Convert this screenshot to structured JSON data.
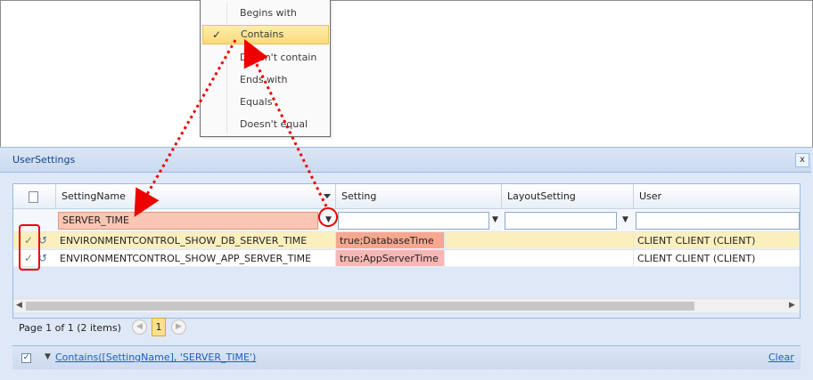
{
  "filter_menu": {
    "items": [
      {
        "label": "Begins with",
        "selected": false
      },
      {
        "label": "Contains",
        "selected": true
      },
      {
        "label": "Doesn't contain",
        "selected": false
      },
      {
        "label": "Ends with",
        "selected": false
      },
      {
        "label": "Equals",
        "selected": false
      },
      {
        "label": "Doesn't equal",
        "selected": false
      }
    ]
  },
  "window": {
    "title": "UserSettings",
    "close_label": "x"
  },
  "grid": {
    "columns": [
      "SettingName",
      "Setting",
      "LayoutSetting",
      "User"
    ],
    "filter_values": {
      "setting_name": "SERVER_TIME",
      "setting": "",
      "layout_setting": "",
      "user": ""
    },
    "rows": [
      {
        "setting_name": "ENVIRONMENTCONTROL_SHOW_DB_SERVER_TIME",
        "setting": "true;DatabaseTime",
        "layout_setting": "",
        "user": "CLIENT CLIENT (CLIENT)"
      },
      {
        "setting_name": "ENVIRONMENTCONTROL_SHOW_APP_SERVER_TIME",
        "setting": "true;AppServerTime",
        "layout_setting": "",
        "user": "CLIENT CLIENT (CLIENT)"
      }
    ]
  },
  "pager": {
    "summary": "Page 1 of 1 (2 items)",
    "current_page": "1"
  },
  "filter_bar": {
    "expression": "Contains([SettingName], 'SERVER_TIME')",
    "clear_label": "Clear"
  },
  "colors": {
    "annotation": "#e00000",
    "filter_highlight": "#fac5b2",
    "selected_row": "#fcefbe"
  }
}
